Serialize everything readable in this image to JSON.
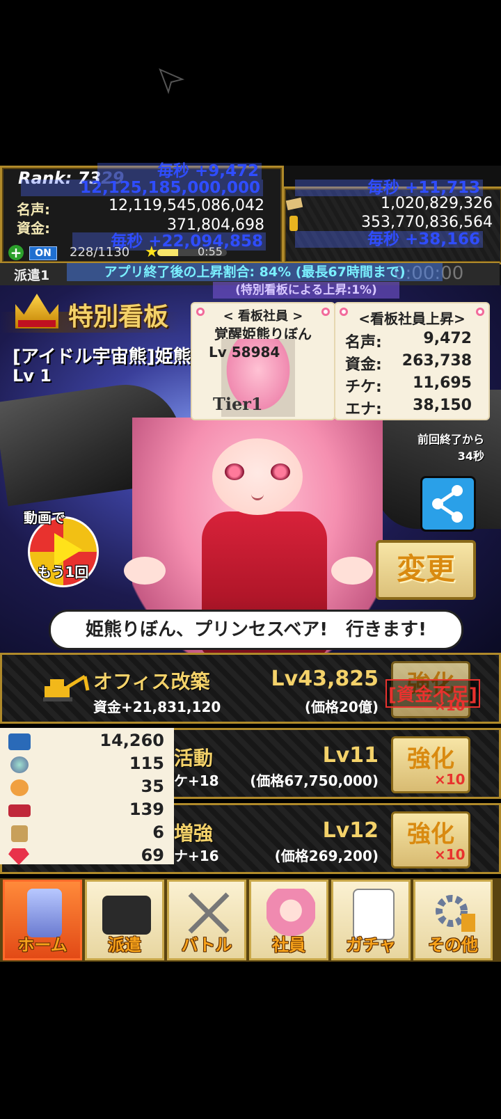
{
  "status_panel": {
    "rank_label": "Rank: 73",
    "rank_faded": "29",
    "fame_per_sec": "毎秒 +9,472",
    "fame_total_overlay": "12,125,185,000,000",
    "fame_label": "名声:",
    "fame_value": "12,119,545,086,042",
    "funds_label": "資金:",
    "funds_value": "371,804,698",
    "funds_per_sec": "毎秒 +22,094,858",
    "toggle_label": "ON",
    "stamina": "228/1130",
    "timer": "0:55",
    "ticket_per_sec": "毎秒 +11,713",
    "ticket_value": "1,020,829,326",
    "energy_value": "353,770,836,564",
    "energy_per_sec": "毎秒 +38,166",
    "dispatch_label": "派遣1",
    "dispatch_time": "0:00:00",
    "offline_rate": "アプリ終了後の上昇割合: 84% (最長67時間まで)",
    "signboard_bonus": "(特別看板による上昇:1%)"
  },
  "signboard": {
    "title": "特別看板",
    "character_name": "[アイドル宇宙熊]姫熊",
    "character_level": "Lv 1",
    "staff_card": {
      "heading": "< 看板社員 >",
      "name": "覚醒姫熊りぼん",
      "level": "Lv 58984",
      "tier": "Tier1"
    },
    "bonus_card": {
      "heading": "<看板社員上昇>",
      "rows": [
        {
          "label": "名声:",
          "value": "9,472"
        },
        {
          "label": "資金:",
          "value": "263,738"
        },
        {
          "label": "チケ:",
          "value": "11,695"
        },
        {
          "label": "エナ:",
          "value": "38,150"
        }
      ]
    },
    "last_close_line1": "前回終了から",
    "last_close_line2": "34秒",
    "video_line1": "動画で",
    "video_line2": "もう1回",
    "change_button": "変更",
    "speech": "姫熊りぼん、プリンセスベア!　行きます!"
  },
  "upgrades": [
    {
      "name": "オフィス改築",
      "effect": "資金+21,831,120",
      "level": "Lv43,825",
      "price": "(価格20億)",
      "button": "強化",
      "multiplier": "×10",
      "warning": "[資金不足]"
    },
    {
      "name": "活動",
      "effect": "ケ+18",
      "level": "Lv11",
      "price": "(価格67,750,000)",
      "button": "強化",
      "multiplier": "×10"
    },
    {
      "name": "増強",
      "effect": "ナ+16",
      "level": "Lv12",
      "price": "(価格269,200)",
      "button": "強化",
      "multiplier": "×10"
    }
  ],
  "items": [
    {
      "icon": "ticket-icon",
      "color": "#2a6ab8",
      "value": "14,260"
    },
    {
      "icon": "orb-icon",
      "color": "#5a8a6a",
      "value": "115"
    },
    {
      "icon": "fist-icon",
      "color": "#f0a040",
      "value": "35"
    },
    {
      "icon": "card-icon",
      "color": "#c0283a",
      "value": "139"
    },
    {
      "icon": "scroll-icon",
      "color": "#c8a05a",
      "value": "6"
    },
    {
      "icon": "gem-icon",
      "color": "#e8324a",
      "value": "69"
    }
  ],
  "nav": [
    {
      "label": "ホーム",
      "icon": "building-icon",
      "active": true
    },
    {
      "label": "派遣",
      "icon": "briefcase-icon",
      "active": false
    },
    {
      "label": "バトル",
      "icon": "swords-icon",
      "active": false
    },
    {
      "label": "社員",
      "icon": "staff-icon",
      "active": false
    },
    {
      "label": "ガチャ",
      "icon": "document-icon",
      "active": false
    },
    {
      "label": "その他",
      "icon": "gear-icon",
      "active": false
    }
  ],
  "colors": {
    "gold": "#f4d26a",
    "overlay_blue": "#2f4dff",
    "warning_red": "#e8322e",
    "share_blue": "#2aa0e8"
  }
}
